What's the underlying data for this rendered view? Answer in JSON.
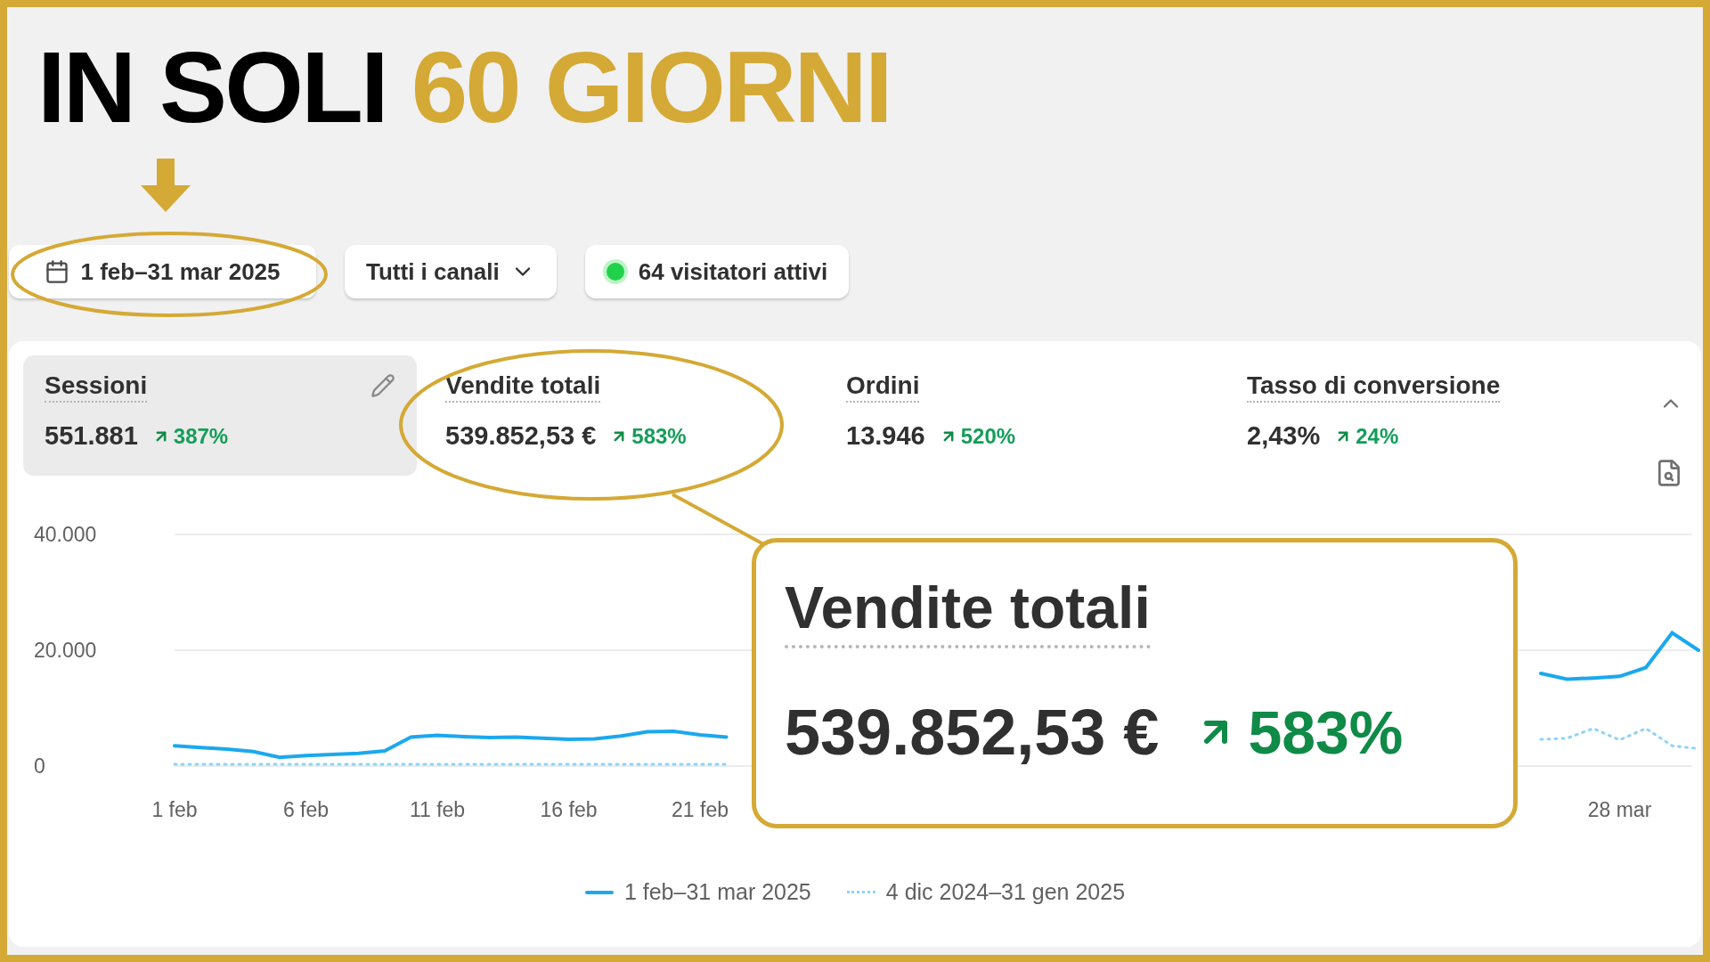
{
  "headline": {
    "parts": [
      {
        "text": "IN SOLI",
        "kind": "plain"
      },
      {
        "text": "60 GIORNI",
        "kind": "accent"
      }
    ]
  },
  "filters": {
    "date_range": "1 feb–31 mar 2025",
    "channels": "Tutti i canali",
    "live_visitors": "64 visitatori attivi"
  },
  "metrics": [
    {
      "label": "Sessioni",
      "value": "551.881",
      "change": "387%",
      "selected": true
    },
    {
      "label": "Vendite totali",
      "value": "539.852,53 €",
      "change": "583%",
      "selected": false
    },
    {
      "label": "Ordini",
      "value": "13.946",
      "change": "520%",
      "selected": false
    },
    {
      "label": "Tasso di conversione",
      "value": "2,43%",
      "change": "24%",
      "selected": false
    }
  ],
  "chart_data": {
    "type": "line",
    "categories": [
      "1 feb",
      null,
      null,
      null,
      null,
      "6 feb",
      null,
      null,
      null,
      null,
      "11 feb",
      null,
      null,
      null,
      null,
      "16 feb",
      null,
      null,
      null,
      null,
      "21 feb",
      null,
      null,
      null,
      null,
      null,
      null,
      null,
      null,
      null,
      null,
      null,
      null,
      null,
      null,
      null,
      null,
      null,
      null,
      null,
      null,
      null,
      null,
      null,
      null,
      null,
      null,
      null,
      null,
      null,
      null,
      null,
      null,
      null,
      null,
      "28 mar",
      null,
      null,
      null
    ],
    "yticks": [
      {
        "value": 0,
        "label": "0"
      },
      {
        "value": 20000,
        "label": "20.000"
      },
      {
        "value": 40000,
        "label": "40.000"
      }
    ],
    "ylim": [
      0,
      40000
    ],
    "series": [
      {
        "name": "1 feb–31 mar 2025",
        "color": "#1ba8ee",
        "line_style": "solid",
        "values": [
          3500,
          3200,
          2900,
          2500,
          1500,
          1800,
          2000,
          2200,
          2600,
          5000,
          5300,
          5100,
          4900,
          5000,
          4800,
          4600,
          4700,
          5200,
          5900,
          6000,
          5400,
          5000,
          null,
          null,
          null,
          null,
          null,
          null,
          null,
          null,
          null,
          null,
          null,
          null,
          null,
          null,
          null,
          null,
          null,
          null,
          null,
          null,
          null,
          null,
          null,
          null,
          null,
          null,
          null,
          null,
          null,
          null,
          16000,
          15000,
          15200,
          15500,
          17000,
          23000,
          20000
        ]
      },
      {
        "name": "4 dic 2024–31 gen 2025",
        "color": "#8fd3f5",
        "line_style": "dotted",
        "values": [
          300,
          300,
          300,
          300,
          300,
          300,
          300,
          300,
          300,
          300,
          300,
          300,
          300,
          300,
          300,
          300,
          300,
          300,
          300,
          300,
          300,
          300,
          null,
          null,
          null,
          null,
          null,
          null,
          null,
          null,
          null,
          null,
          null,
          null,
          null,
          null,
          null,
          null,
          null,
          null,
          null,
          null,
          null,
          null,
          null,
          null,
          null,
          null,
          null,
          null,
          null,
          null,
          4600,
          4800,
          6500,
          4500,
          6500,
          3500,
          3000
        ]
      }
    ]
  },
  "callout": {
    "label": "Vendite totali",
    "value": "539.852,53 €",
    "change": "583%"
  }
}
